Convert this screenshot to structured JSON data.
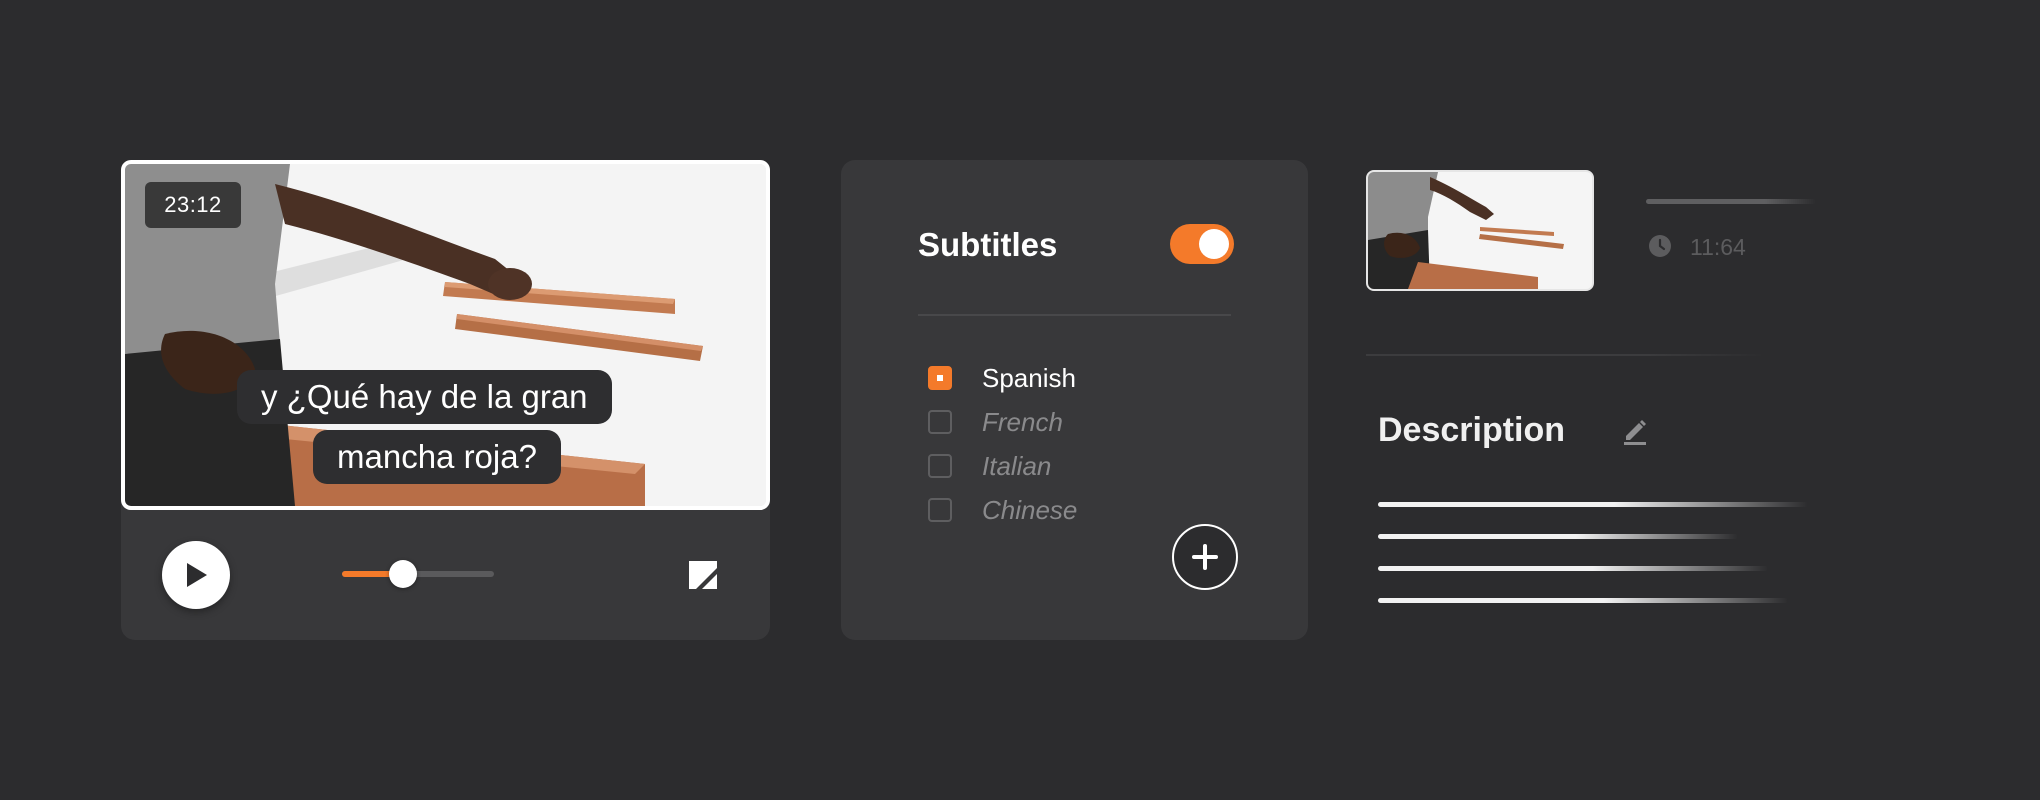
{
  "colors": {
    "background": "#2c2c2e",
    "card": "#38383a",
    "accent": "#f47a2a"
  },
  "player": {
    "timestamp": "23:12",
    "caption_line1": "y ¿Qué hay de la gran",
    "caption_line2": "mancha roja?",
    "progress_percent": 40,
    "icons": {
      "play": "play-icon",
      "fullscreen": "fullscreen-icon"
    }
  },
  "subtitles": {
    "title": "Subtitles",
    "enabled": true,
    "languages": [
      {
        "label": "Spanish",
        "checked": true
      },
      {
        "label": "French",
        "checked": false
      },
      {
        "label": "Italian",
        "checked": false
      },
      {
        "label": "Chinese",
        "checked": false
      }
    ],
    "icons": {
      "add": "plus-icon"
    }
  },
  "details": {
    "duration": "11:64",
    "description_title": "Description",
    "icons": {
      "clock": "clock-icon",
      "edit": "pencil-icon"
    }
  }
}
